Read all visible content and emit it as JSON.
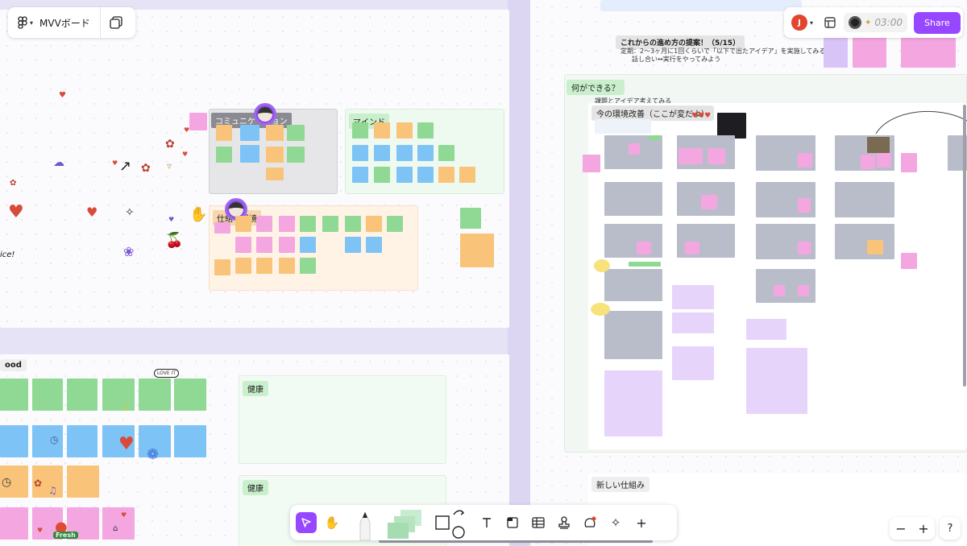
{
  "app": {
    "board_title": "MVVボード",
    "share_label": "Share",
    "timer": "03:00",
    "user_initial": "J"
  },
  "left_board": {
    "communication_label": "コミュニケーション",
    "mind_label": "マインド",
    "environment_label": "仕組・環境",
    "doodle_text": "ice!"
  },
  "bottom_board": {
    "mood_label": "ood",
    "health_label_1": "健康",
    "health_label_2": "健康",
    "sticker_love": "LOVE IT",
    "sticker_fresh": "Fresh"
  },
  "right_board": {
    "proposal_title": "これからの進め方の提案！（5/15）",
    "proposal_line1": "定期：2〜3ヶ月に1回くらいで「以下で出たアイデア」を実施してみる",
    "proposal_line2": "話し合い↔実行をやってみよう",
    "what_can_we_do": "何ができる？",
    "subtitle": "課題とアイデア考えてみる",
    "env_improve": "今の環境改善（ここが変だよ）",
    "new_system": "新しい仕組み"
  },
  "toolbar": {
    "tools": [
      {
        "name": "select-tool",
        "icon": "cursor-icon"
      },
      {
        "name": "hand-tool",
        "icon": "hand-icon"
      },
      {
        "name": "pen-tool",
        "icon": "pen-icon"
      },
      {
        "name": "sticky-tool",
        "icon": "sticky-stack-icon"
      },
      {
        "name": "shape-tool",
        "icon": "shape-icon"
      },
      {
        "name": "text-tool",
        "icon": "text-icon"
      },
      {
        "name": "section-tool",
        "icon": "section-icon"
      },
      {
        "name": "table-tool",
        "icon": "table-icon"
      },
      {
        "name": "stamp-tool",
        "icon": "stamp-icon"
      },
      {
        "name": "widget-tool",
        "icon": "widget-icon"
      },
      {
        "name": "ai-tool",
        "icon": "sparkle-icon"
      },
      {
        "name": "more-tool",
        "icon": "plus-icon"
      }
    ]
  },
  "zoom": {
    "minus": "−",
    "plus": "+",
    "help": "?"
  },
  "colors": {
    "accent": "#9747ff",
    "sticky_green": "#8fd994",
    "sticky_blue": "#7ec3f5",
    "sticky_orange": "#f9c479",
    "sticky_pink": "#f4a6e1",
    "sticky_purple": "#d9c4f7"
  }
}
